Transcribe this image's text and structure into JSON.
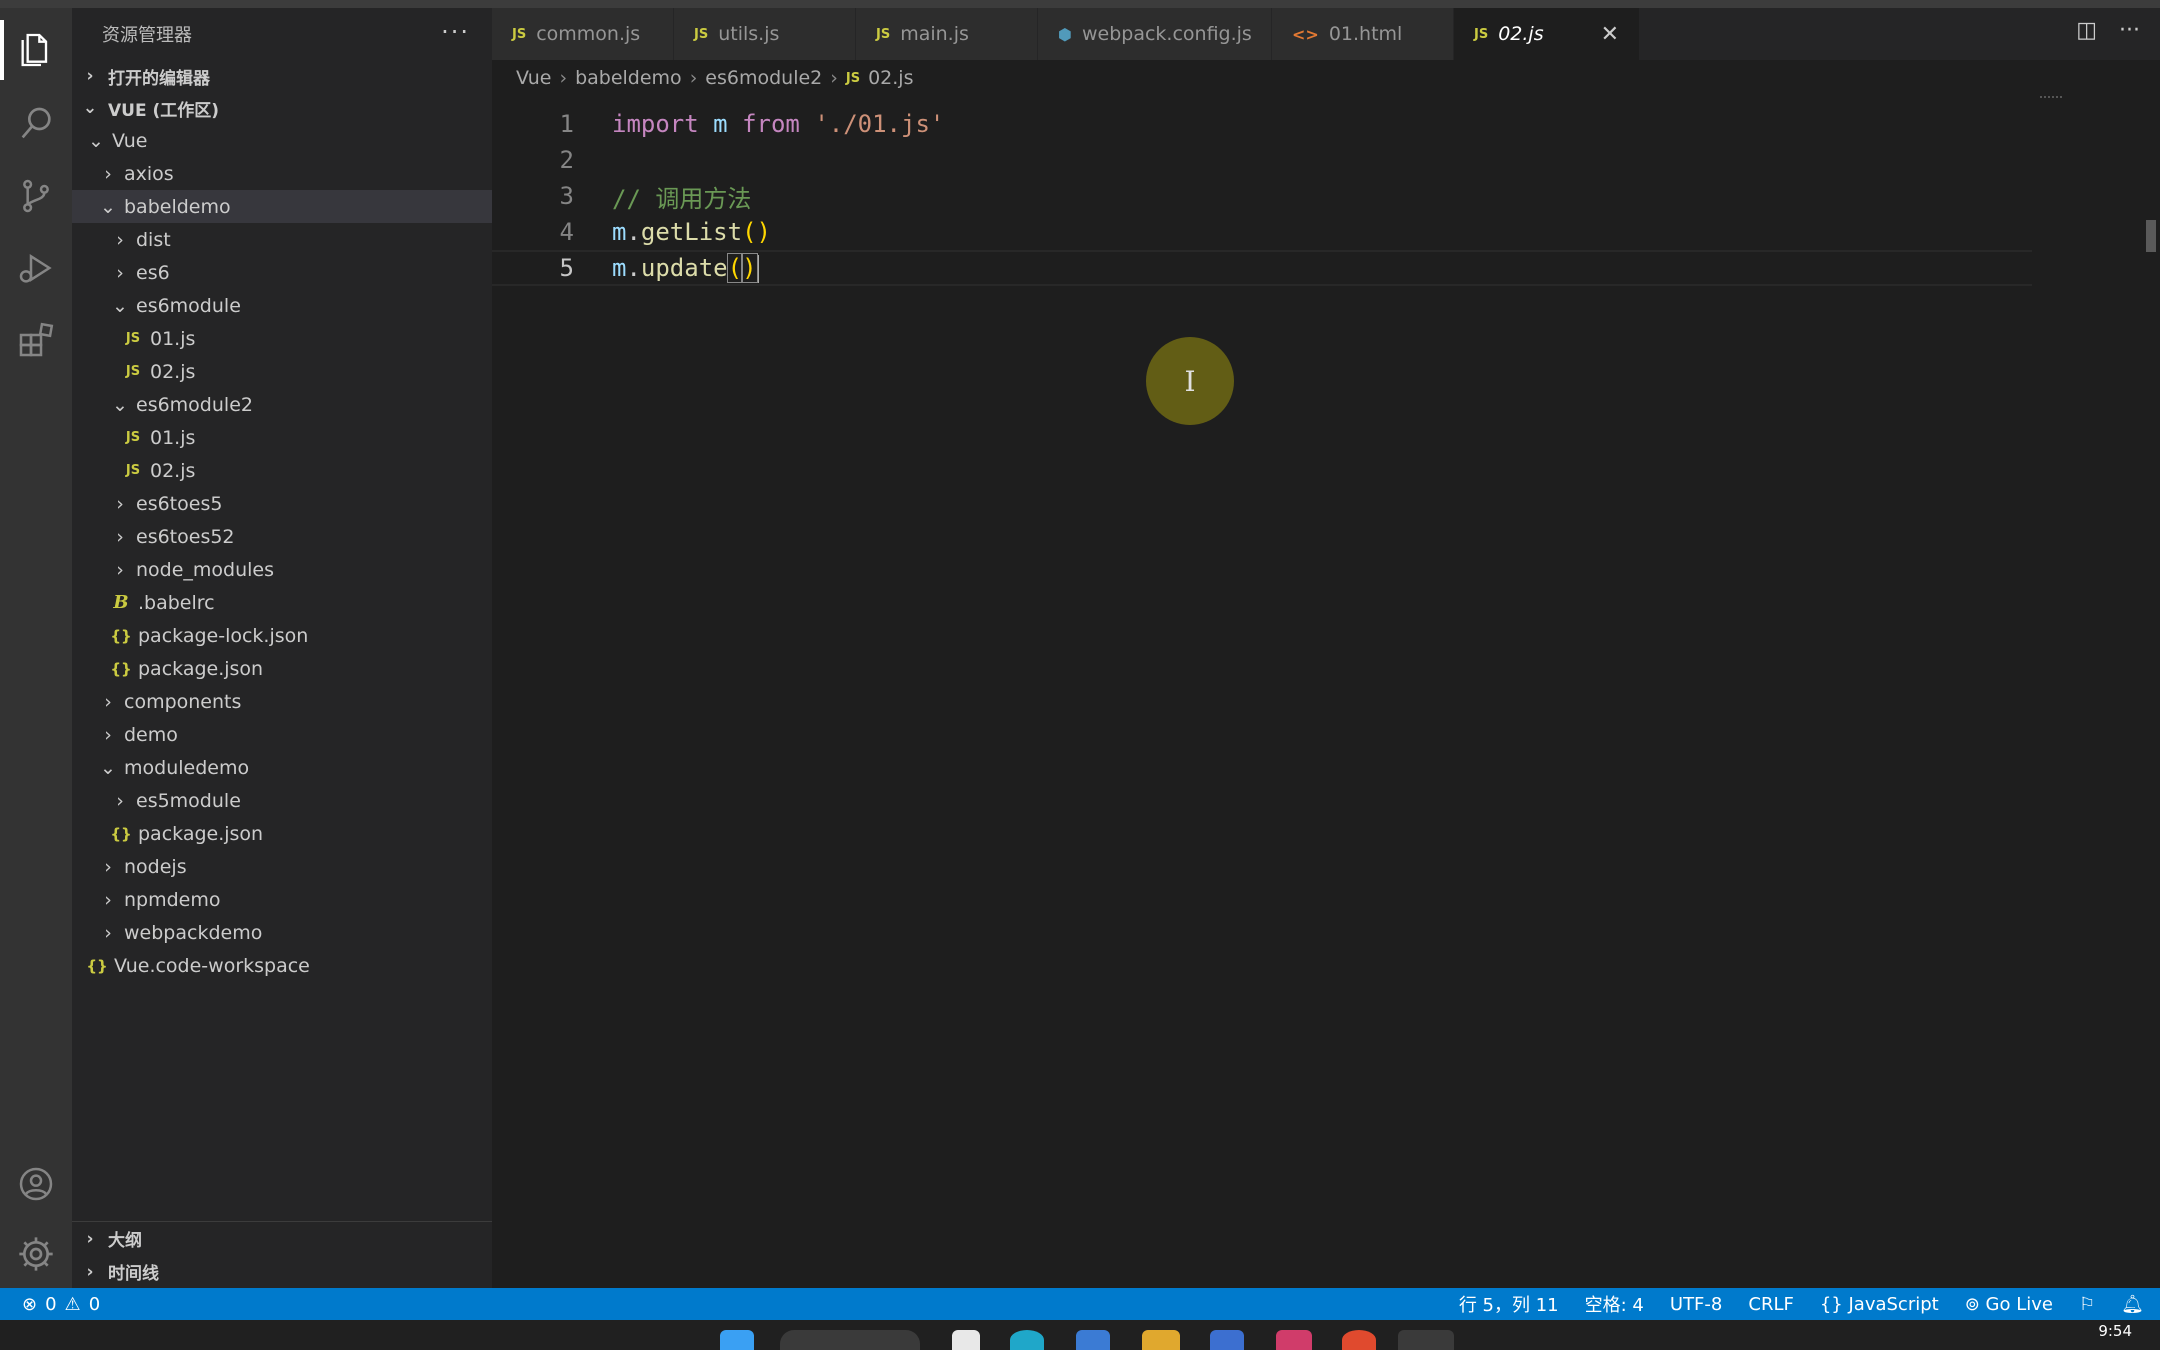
{
  "sidebar": {
    "title": "资源管理器",
    "more": "···",
    "open_editors": "打开的编辑器",
    "workspace": "VUE (工作区)",
    "tree": [
      {
        "label": "Vue",
        "depth": 1,
        "kind": "folder-open"
      },
      {
        "label": "axios",
        "depth": 2,
        "kind": "folder"
      },
      {
        "label": "babeldemo",
        "depth": 2,
        "kind": "folder-open",
        "selected": true
      },
      {
        "label": "dist",
        "depth": 3,
        "kind": "folder"
      },
      {
        "label": "es6",
        "depth": 3,
        "kind": "folder"
      },
      {
        "label": "es6module",
        "depth": 3,
        "kind": "folder-open"
      },
      {
        "label": "01.js",
        "depth": 4,
        "kind": "js"
      },
      {
        "label": "02.js",
        "depth": 4,
        "kind": "js"
      },
      {
        "label": "es6module2",
        "depth": 3,
        "kind": "folder-open"
      },
      {
        "label": "01.js",
        "depth": 4,
        "kind": "js"
      },
      {
        "label": "02.js",
        "depth": 4,
        "kind": "js"
      },
      {
        "label": "es6toes5",
        "depth": 3,
        "kind": "folder"
      },
      {
        "label": "es6toes52",
        "depth": 3,
        "kind": "folder"
      },
      {
        "label": "node_modules",
        "depth": 3,
        "kind": "folder"
      },
      {
        "label": ".babelrc",
        "depth": 3,
        "kind": "babel"
      },
      {
        "label": "package-lock.json",
        "depth": 3,
        "kind": "json"
      },
      {
        "label": "package.json",
        "depth": 3,
        "kind": "json"
      },
      {
        "label": "components",
        "depth": 2,
        "kind": "folder"
      },
      {
        "label": "demo",
        "depth": 2,
        "kind": "folder"
      },
      {
        "label": "moduledemo",
        "depth": 2,
        "kind": "folder-open"
      },
      {
        "label": "es5module",
        "depth": 3,
        "kind": "folder"
      },
      {
        "label": "package.json",
        "depth": 3,
        "kind": "json"
      },
      {
        "label": "nodejs",
        "depth": 2,
        "kind": "folder"
      },
      {
        "label": "npmdemo",
        "depth": 2,
        "kind": "folder"
      },
      {
        "label": "webpackdemo",
        "depth": 2,
        "kind": "folder"
      },
      {
        "label": "Vue.code-workspace",
        "depth": 1,
        "kind": "json"
      }
    ],
    "outline": "大纲",
    "timeline": "时间线"
  },
  "tabs": [
    {
      "label": "common.js",
      "icon": "JS"
    },
    {
      "label": "utils.js",
      "icon": "JS"
    },
    {
      "label": "main.js",
      "icon": "JS"
    },
    {
      "label": "webpack.config.js",
      "icon": "⬢"
    },
    {
      "label": "01.html",
      "icon": "<>"
    },
    {
      "label": "02.js",
      "icon": "JS",
      "active": true
    }
  ],
  "breadcrumb": [
    "Vue",
    "babeldemo",
    "es6module2",
    "02.js"
  ],
  "breadcrumb_file_icon": "JS",
  "editor": {
    "lines": [
      {
        "n": "1",
        "tokens": [
          [
            "kw",
            "import"
          ],
          [
            "plain",
            " "
          ],
          [
            "var",
            "m"
          ],
          [
            "plain",
            " "
          ],
          [
            "kw",
            "from"
          ],
          [
            "plain",
            " "
          ],
          [
            "str",
            "'./01.js'"
          ]
        ]
      },
      {
        "n": "2",
        "tokens": []
      },
      {
        "n": "3",
        "tokens": [
          [
            "cmt",
            "// 调用方法"
          ]
        ]
      },
      {
        "n": "4",
        "tokens": [
          [
            "var",
            "m"
          ],
          [
            "plain",
            "."
          ],
          [
            "fn",
            "getList"
          ],
          [
            "br",
            "()"
          ]
        ]
      },
      {
        "n": "5",
        "tokens": [
          [
            "var",
            "m"
          ],
          [
            "plain",
            "."
          ],
          [
            "fn",
            "update"
          ],
          [
            "br-hl",
            "("
          ],
          [
            "br-hl",
            ")"
          ],
          [
            "cursor",
            ""
          ]
        ],
        "current": true
      }
    ],
    "cursor_glyph": "I"
  },
  "status": {
    "errors": "0",
    "warnings": "0",
    "position": "行 5，列 11",
    "spaces": "空格: 4",
    "encoding": "UTF-8",
    "eol": "CRLF",
    "language": "JavaScript",
    "language_icon": "{}",
    "golive": "Go Live"
  },
  "clock": "9:54",
  "colors": {
    "accent": "#007acc",
    "js_icon": "#cbcb41",
    "html_icon": "#e37933",
    "config_icon": "#519aba"
  }
}
